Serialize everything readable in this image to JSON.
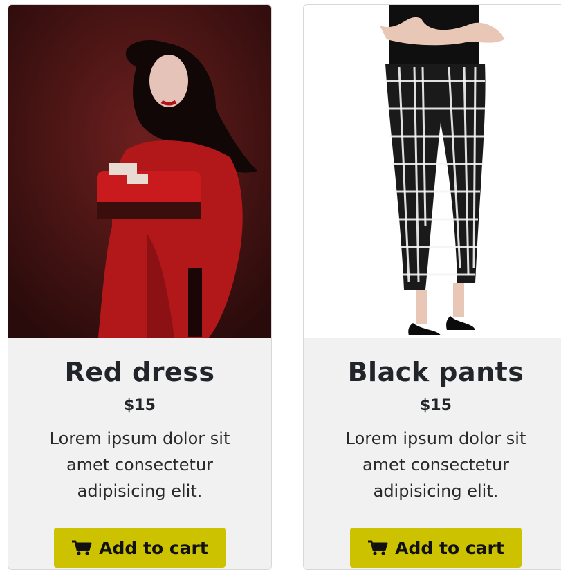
{
  "products": [
    {
      "title": "Red dress",
      "price": "$15",
      "description": "Lorem ipsum dolor sit amet consectetur adipisicing elit.",
      "button_label": "Add to cart",
      "button_icon": "cart-icon"
    },
    {
      "title": "Black pants",
      "price": "$15",
      "description": "Lorem ipsum dolor sit amet consectetur adipisicing elit.",
      "button_label": "Add to cart",
      "button_icon": "cart-icon"
    }
  ],
  "colors": {
    "button": "#cdc200",
    "card_body": "#f1f1f1",
    "text": "#212529"
  }
}
